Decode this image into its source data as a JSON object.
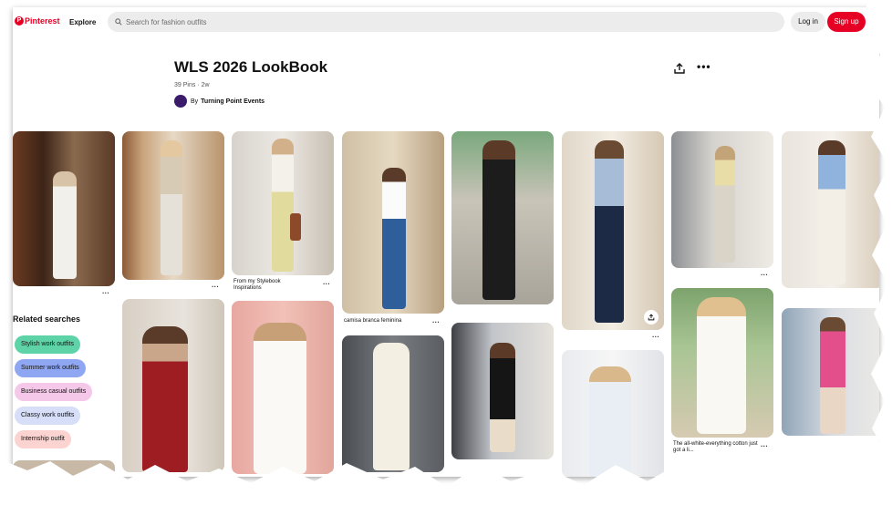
{
  "header": {
    "logo_text": "Pinterest",
    "explore": "Explore",
    "search_placeholder": "Search for fashion outfits",
    "login": "Log in",
    "signup": "Sign up",
    "brand_color": "#e60023"
  },
  "board": {
    "title": "WLS 2026 LookBook",
    "meta": "39 Pins · 2w",
    "owner_prefix": "By",
    "owner": "Turning Point Events"
  },
  "pins": {
    "captions": {
      "c3": "From my Stylebook Inspirations",
      "c4": "camisa branca feminina",
      "c7": "The all-white-everything cotton just got a li..."
    }
  },
  "related": {
    "heading": "Related searches",
    "chips": [
      {
        "label": "Stylish work outfits",
        "color": "#5ed3a8"
      },
      {
        "label": "Summer work outfits",
        "color": "#8fa7f2"
      },
      {
        "label": "Business casual outfits",
        "color": "#f5c7e8"
      },
      {
        "label": "Classy work outfits",
        "color": "#d6def8"
      },
      {
        "label": "Internship outfit",
        "color": "#fbd3d0"
      }
    ]
  }
}
